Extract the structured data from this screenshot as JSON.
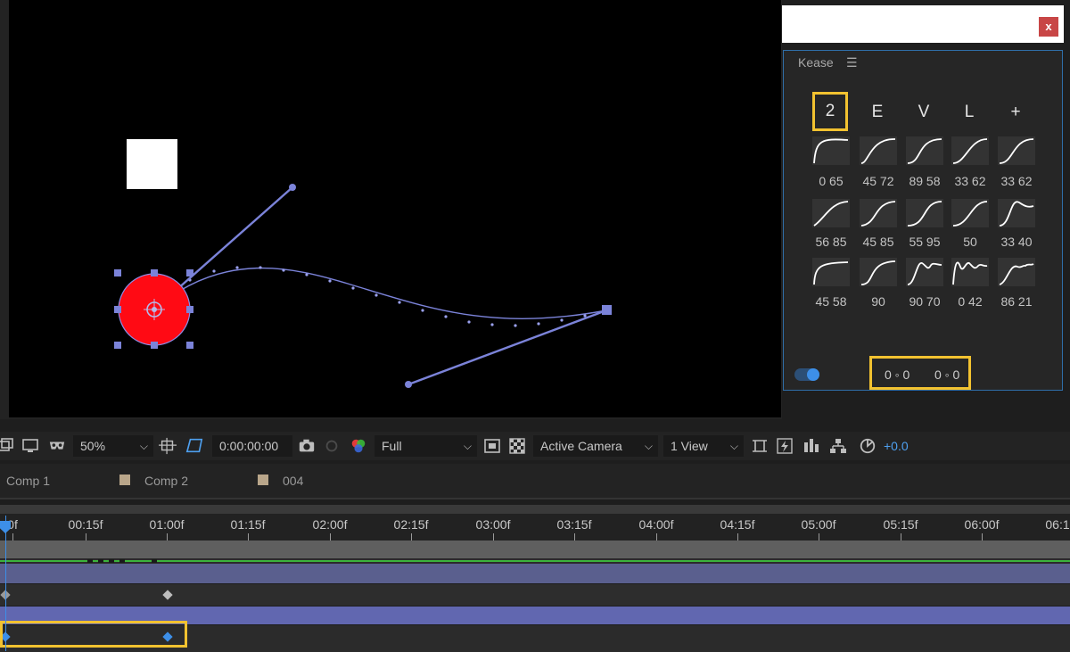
{
  "kease": {
    "panel_title": "Kease",
    "menu_icon": "hamburger-icon",
    "close_label": "x",
    "tabs": [
      "2",
      "E",
      "V",
      "L",
      "+"
    ],
    "active_tab": "2",
    "presets": [
      {
        "label": "0 65"
      },
      {
        "label": "45 72"
      },
      {
        "label": "89 58"
      },
      {
        "label": "33 62"
      },
      {
        "label": "33 62"
      },
      {
        "label": "56 85"
      },
      {
        "label": "45 85"
      },
      {
        "label": "55 95"
      },
      {
        "label": "50"
      },
      {
        "label": "33 40"
      },
      {
        "label": "45 58"
      },
      {
        "label": "90"
      },
      {
        "label": "90 70"
      },
      {
        "label": "0 42"
      },
      {
        "label": "86 21"
      }
    ],
    "value_left": "0 ◦ 0",
    "value_right": "0 ◦ 0"
  },
  "toolbar": {
    "zoom": "50%",
    "timecode": "0:00:00:00",
    "resolution": "Full",
    "camera": "Active Camera",
    "views": "1 View",
    "exposure": "+0.0"
  },
  "comp_tabs": [
    {
      "label": "Comp 1"
    },
    {
      "label": "Comp 2"
    },
    {
      "label": "004"
    }
  ],
  "ruler_labels": [
    "0f",
    "00:15f",
    "01:00f",
    "01:15f",
    "02:00f",
    "02:15f",
    "03:00f",
    "03:15f",
    "04:00f",
    "04:15f",
    "05:00f",
    "05:15f",
    "06:00f",
    "06:1"
  ],
  "colors": {
    "accent": "#3d8fe8",
    "highlight": "#f2c230",
    "circle_fill": "#ff0a14",
    "path": "#7b83d9",
    "layer_bar": "#6167b0"
  }
}
